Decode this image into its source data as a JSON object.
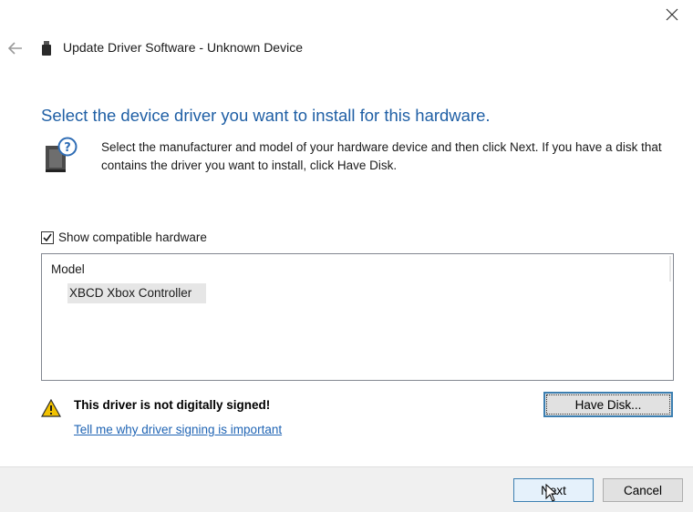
{
  "window": {
    "title": "Update Driver Software - Unknown Device",
    "close_icon": "close-icon",
    "back_icon": "back-arrow-icon",
    "device_icon": "usb-device-icon"
  },
  "main": {
    "heading": "Select the device driver you want to install for this hardware.",
    "instructions": "Select the manufacturer and model of your hardware device and then click Next. If you have a disk that contains the driver you want to install, click Have Disk.",
    "info_icon": "hardware-help-icon"
  },
  "compatible": {
    "label": "Show compatible hardware",
    "checked": true
  },
  "model_list": {
    "header": "Model",
    "items": [
      "XBCD Xbox Controller"
    ]
  },
  "warning": {
    "icon": "warning-icon",
    "text": "This driver is not digitally signed!",
    "link": "Tell me why driver signing is important"
  },
  "buttons": {
    "have_disk": "Have Disk...",
    "next": "Next",
    "cancel": "Cancel"
  },
  "colors": {
    "heading": "#1f5fa5",
    "link": "#1f64b4",
    "focus_border": "#3c7fb1",
    "footer_bg": "#f0f0f0"
  }
}
